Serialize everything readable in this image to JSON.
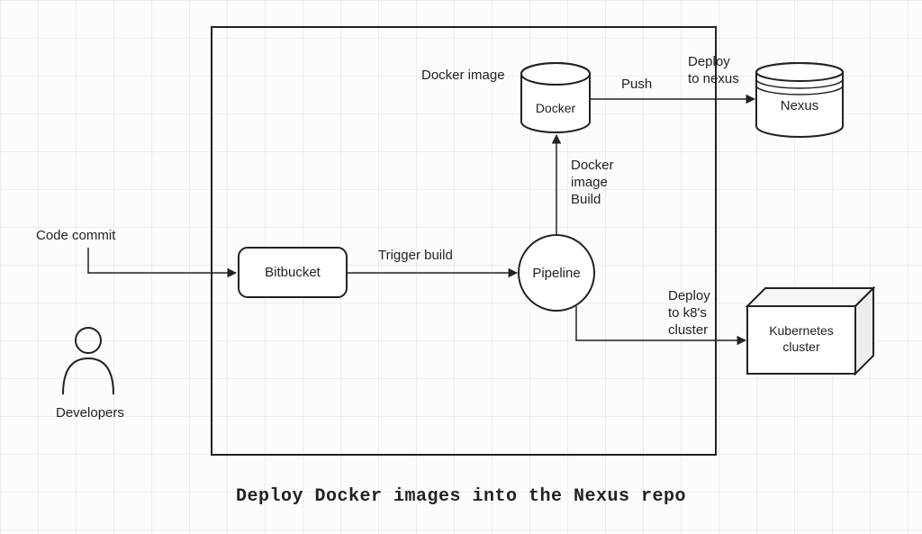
{
  "diagram": {
    "title": "Deploy Docker images into the Nexus repo",
    "nodes": {
      "developers": "Developers",
      "bitbucket": "Bitbucket",
      "pipeline": "Pipeline",
      "docker": "Docker",
      "nexus": "Nexus",
      "k8s": "Kubernetes cluster"
    },
    "edges": {
      "code_commit": "Code commit",
      "trigger_build": "Trigger build",
      "docker_build": "Docker image\nBuild",
      "docker_image": "Docker image",
      "push": "Push",
      "deploy_nexus": "Deploy to nexus",
      "deploy_k8s": "Deploy to k8's cluster"
    }
  }
}
